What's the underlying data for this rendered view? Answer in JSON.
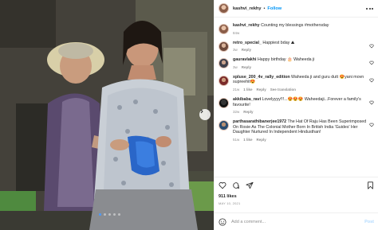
{
  "post": {
    "username": "kashvi_rekhy",
    "separator": "•",
    "follow_label": "Follow"
  },
  "caption": {
    "username": "kashvi_rekhy",
    "text": "Counting my blessings #mothersday",
    "time": "84w"
  },
  "comments": [
    {
      "username": "retro_special_",
      "text": "Happiest bday ⛰",
      "time": "3w",
      "reply": "Reply",
      "translation": ""
    },
    {
      "username": "gauravlakhi",
      "text": "Happy birthday 🎂 Waheeda ji",
      "time": "3w",
      "reply": "Reply",
      "translation": ""
    },
    {
      "username": "xpluse_200_4v_rally_edition",
      "text": "Waheeda ji and guru dutt 😍yani movn supreehit😍",
      "time": "21w",
      "likes": "1 like",
      "reply": "Reply",
      "translation": "See translation"
    },
    {
      "username": "akkibaba_ravi",
      "text": "Lovelyyyy!!!...😍😍😍 Waheedaji...Forever a family's favourite!",
      "time": "32w",
      "reply": "Reply",
      "translation": ""
    },
    {
      "username": "parthasarathibanerjee1972",
      "text": "The Hat Of Raju Has Been Superimposed On Rosie As The Colonial Mother Born In British India 'Guides' Her Daughter Nurtured In Independent Hindusthan!",
      "time": "51w",
      "likes": "1 like",
      "reply": "Reply",
      "translation": ""
    }
  ],
  "actions": {
    "likes": "911 likes",
    "date": "MAY 10, 2021"
  },
  "composer": {
    "placeholder": "Add a comment...",
    "post_label": "Post"
  },
  "icons": {
    "heart": "heart-icon",
    "comment": "comment-icon",
    "share": "share-icon",
    "bookmark": "bookmark-icon",
    "emoji": "emoji-icon",
    "more": "more-icon",
    "next": "chevron-right-icon"
  },
  "colors": {
    "link": "#0095f6",
    "post_disabled": "#b3dbff",
    "text": "#262626",
    "muted": "#8e8e8e"
  }
}
